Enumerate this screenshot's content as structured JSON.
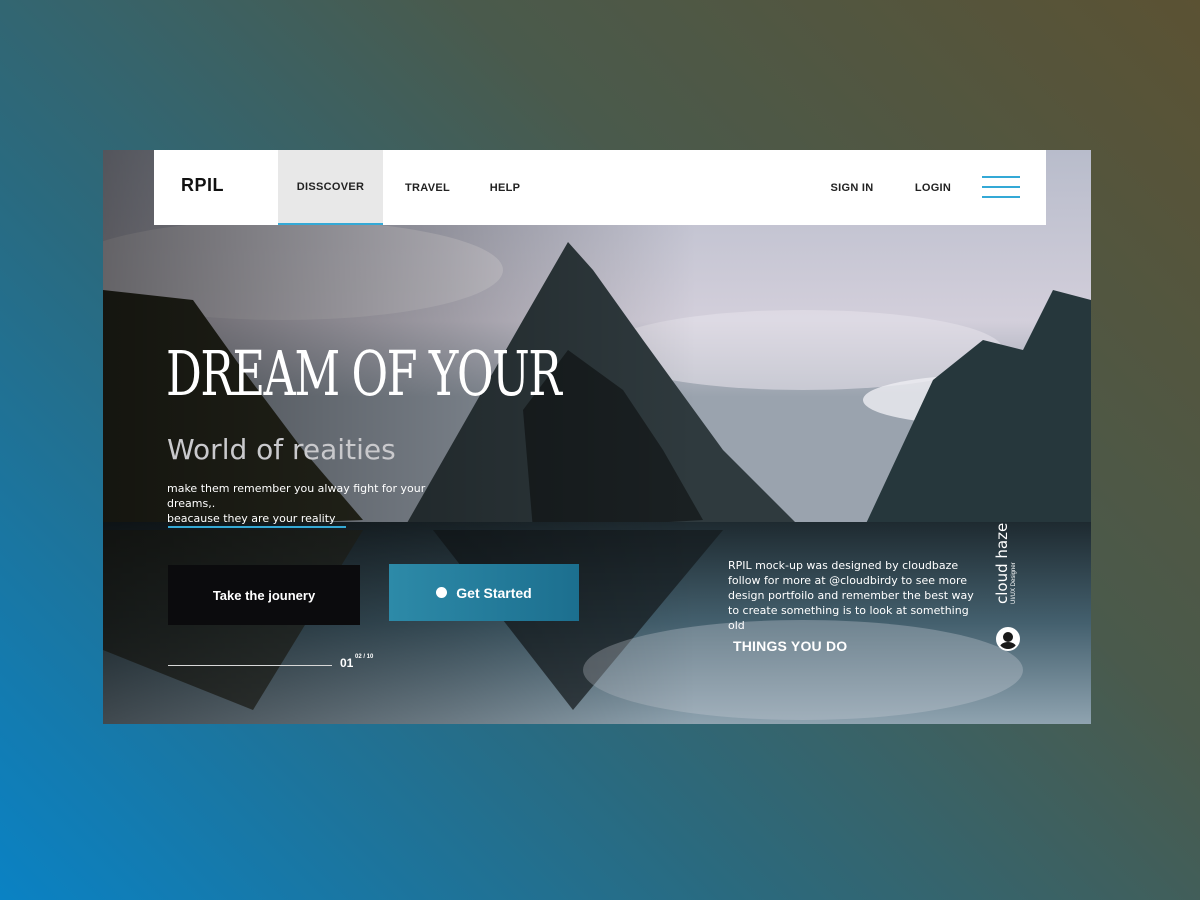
{
  "nav": {
    "brand": "RPIL",
    "items": [
      {
        "label": "DISSCOVER",
        "active": true
      },
      {
        "label": "TRAVEL",
        "active": false
      },
      {
        "label": "HELP",
        "active": false
      }
    ],
    "sign_in": "SIGN IN",
    "login": "LOGIN",
    "menu_icon": "hamburger-menu-icon"
  },
  "hero": {
    "title": "DREAM OF YOUR",
    "subtitle": "World of reaities",
    "description_line1": "make them remember you alway fight for your dreams,.",
    "description_line2": "beacause they are your reality"
  },
  "actions": {
    "journey_label": "Take the jounery",
    "started_label": "Get Started"
  },
  "pagination": {
    "current": "01",
    "total": "02 / 10"
  },
  "credit": {
    "line1": "RPIL mock-up was designed by cloudbaze",
    "line2": "follow for more at @cloudbirdy to see more",
    "line3": "design portfoilo and remember the best way",
    "line4": "to create something is to look at something old"
  },
  "things_link": "THINGS YOU DO",
  "designer": {
    "name": "cloud haze",
    "role": "UI/UX Designer"
  },
  "colors": {
    "accent": "#34a9d6",
    "button_dark": "#0b0b0d",
    "button_teal": "#2d8aa8"
  }
}
